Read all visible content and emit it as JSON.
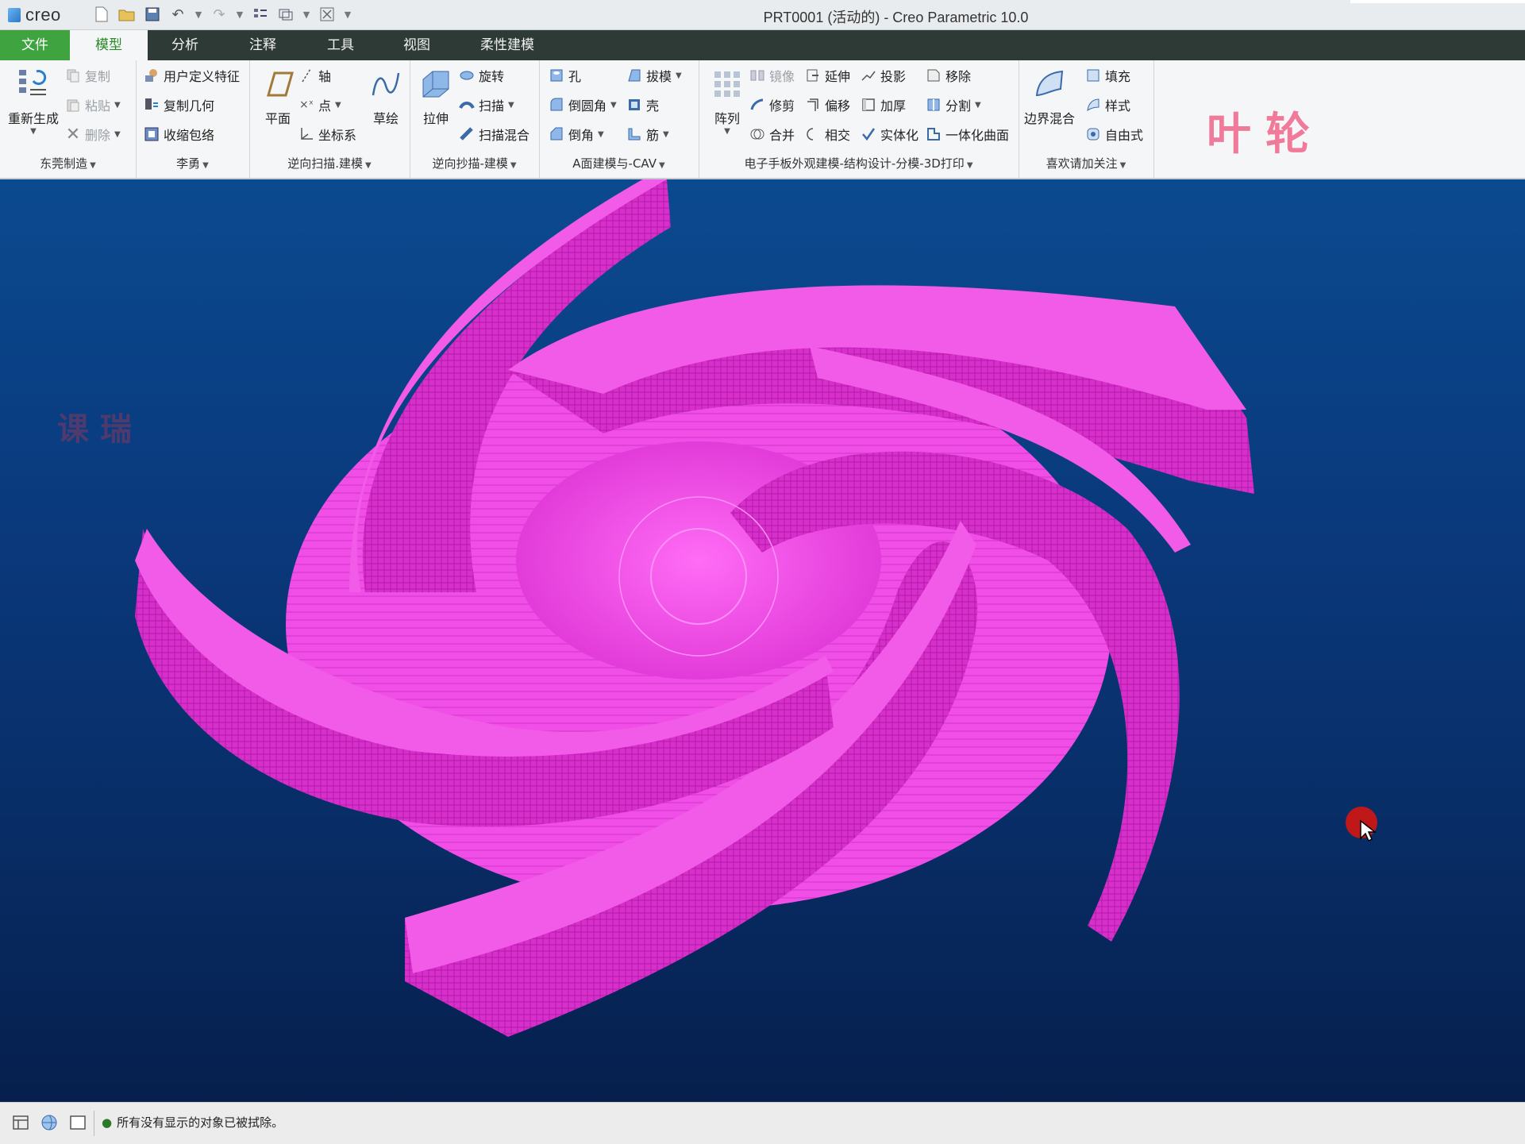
{
  "window": {
    "brand": "creo",
    "title": "PRT0001 (活动的) - Creo Parametric 10.0"
  },
  "tabs": [
    {
      "label": "文件"
    },
    {
      "label": "模型"
    },
    {
      "label": "分析"
    },
    {
      "label": "注释"
    },
    {
      "label": "工具"
    },
    {
      "label": "视图"
    },
    {
      "label": "柔性建模"
    }
  ],
  "ribbon": {
    "g1": {
      "label": "东莞制造",
      "regen": "重新生成",
      "copy": "复制",
      "paste": "粘贴",
      "delete": "删除"
    },
    "g2": {
      "label": "李勇",
      "udf": "用户定义特征",
      "copygeom": "复制几何",
      "shrinkwrap": "收缩包络"
    },
    "g3": {
      "label": "逆向扫描.建模",
      "plane": "平面",
      "axis": "轴",
      "point": "点",
      "csys": "坐标系",
      "sketch": "草绘"
    },
    "g4": {
      "label": "逆向抄描-建模",
      "extrude": "拉伸",
      "revolve": "旋转",
      "sweep": "扫描",
      "sweepblend": "扫描混合"
    },
    "g5": {
      "label": "A面建模与-CAV",
      "hole": "孔",
      "round": "倒圆角",
      "chamfer": "倒角",
      "draft": "拔模",
      "shell": "壳",
      "rib": "筋"
    },
    "g6": {
      "label": "电子手板外观建模-结构设计-分模-3D打印",
      "pattern": "阵列",
      "mirror": "镜像",
      "extend": "延伸",
      "project": "投影",
      "move": "移除",
      "trim": "修剪",
      "offset": "偏移",
      "thicken": "加厚",
      "split": "分割",
      "merge": "合并",
      "intersect": "相交",
      "solidify": "实体化",
      "unify": "一体化曲面"
    },
    "g7": {
      "label": "喜欢请加关注",
      "boundary": "边界混合",
      "fill": "填充",
      "style": "样式",
      "freestyle": "自由式"
    }
  },
  "overlay_title": "叶轮",
  "watermark": "课 瑞",
  "status": {
    "message": "所有没有显示的对象已被拭除。"
  },
  "colors": {
    "part": "#e63ad8",
    "tab_file": "#3fa33f",
    "tab_bar": "#2d3a36"
  }
}
